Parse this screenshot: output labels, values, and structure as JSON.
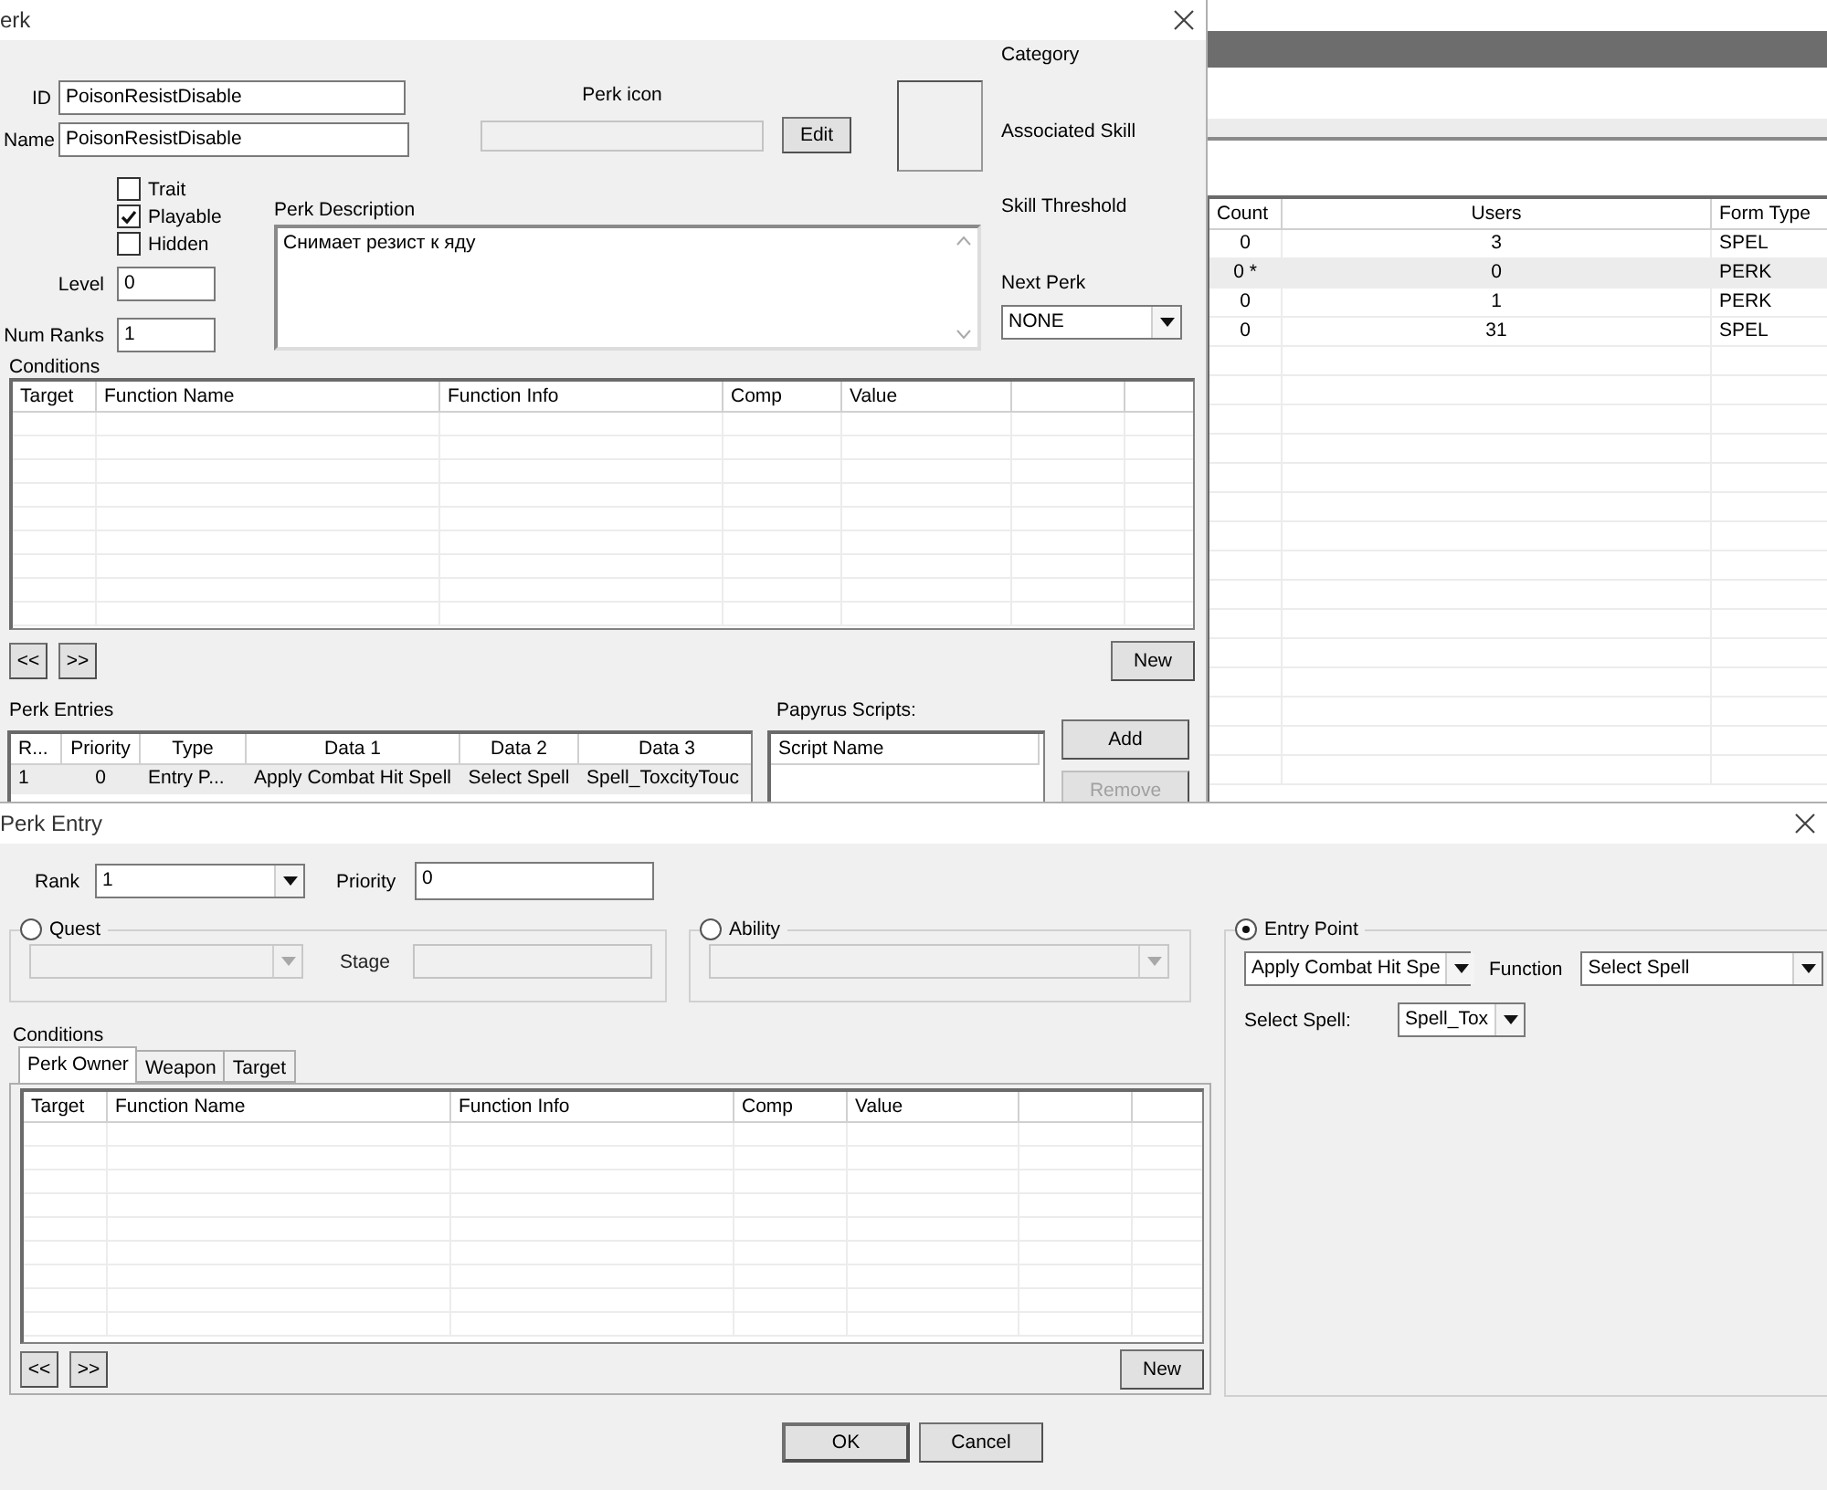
{
  "background_window": {
    "table": {
      "columns": [
        "Count",
        "Users",
        "Form Type"
      ],
      "rows": [
        {
          "cells": [
            "0",
            "3",
            "SPEL"
          ],
          "selected": false
        },
        {
          "cells": [
            "0 *",
            "0",
            "PERK"
          ],
          "selected": true
        },
        {
          "cells": [
            "0",
            "1",
            "PERK"
          ],
          "selected": false
        },
        {
          "cells": [
            "0",
            "31",
            "SPEL"
          ],
          "selected": false
        }
      ]
    }
  },
  "perk_window": {
    "title": "erk",
    "id_label": "ID",
    "id": "PoisonResistDisable",
    "name_label": "Name",
    "name": "PoisonResistDisable",
    "flags": [
      {
        "label": "Trait",
        "checked": false
      },
      {
        "label": "Playable",
        "checked": true
      },
      {
        "label": "Hidden",
        "checked": false
      }
    ],
    "level_label": "Level",
    "level": "0",
    "num_ranks_label": "Num Ranks",
    "num_ranks": "1",
    "perk_icon_label": "Perk icon",
    "edit_button": "Edit",
    "description_label": "Perk Description",
    "description": "Снимает резист к яду",
    "category_label": "Category",
    "associated_skill_label": "Associated Skill",
    "skill_threshold_label": "Skill Threshold",
    "next_perk_label": "Next Perk",
    "next_perk": "NONE",
    "conditions": {
      "label": "Conditions",
      "columns": [
        "Target",
        "Function Name",
        "Function Info",
        "Comp",
        "Value"
      ],
      "prev_button": "<<",
      "next_button": ">>",
      "new_button": "New"
    },
    "perk_entries": {
      "label": "Perk Entries",
      "columns": [
        "R...",
        "Priority",
        "Type",
        "Data 1",
        "Data 2",
        "Data 3"
      ],
      "rows": [
        {
          "cells": [
            "1",
            "0",
            "Entry P...",
            "Apply Combat Hit Spell",
            "Select Spell",
            "Spell_ToxcityTouc"
          ],
          "selected": true
        }
      ]
    },
    "papyrus": {
      "label": "Papyrus Scripts:",
      "columns": [
        "Script Name"
      ],
      "add_button": "Add",
      "remove_button": {
        "label": "Remove",
        "disabled": true
      }
    }
  },
  "perk_entry_window": {
    "title": "Perk Entry",
    "rank_label": "Rank",
    "rank": "1",
    "priority_label": "Priority",
    "priority": "0",
    "quest": {
      "label": "Quest",
      "selected": false,
      "stage_label": "Stage"
    },
    "ability": {
      "label": "Ability",
      "selected": false
    },
    "entry_point": {
      "label": "Entry Point",
      "selected": true,
      "entry": "Apply Combat Hit Spe",
      "function_label": "Function",
      "function": "Select Spell",
      "select_spell_label": "Select Spell:",
      "spell": "Spell_Tox"
    },
    "conditions": {
      "label": "Conditions",
      "tabs": [
        {
          "label": "Perk Owner",
          "selected": true
        },
        {
          "label": "Weapon",
          "selected": false
        },
        {
          "label": "Target",
          "selected": false
        }
      ],
      "columns": [
        "Target",
        "Function Name",
        "Function Info",
        "Comp",
        "Value"
      ],
      "prev_button": "<<",
      "next_button": ">>",
      "new_button": "New"
    },
    "ok_button": "OK",
    "cancel_button": "Cancel"
  }
}
